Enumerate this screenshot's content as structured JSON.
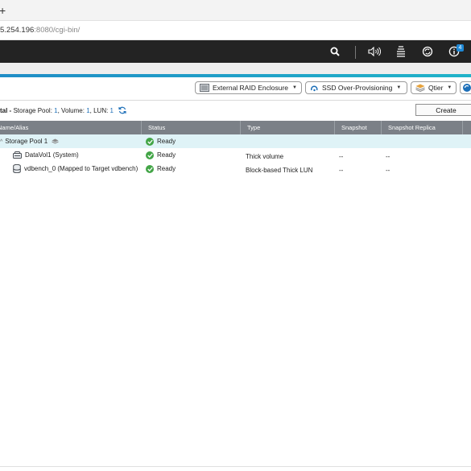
{
  "browser": {
    "new_tab_glyph": "+",
    "url_host": "5.254.196",
    "url_rest": ":8080/cgi-bin/"
  },
  "topnav": {
    "icons": [
      "search-icon",
      "volume-icon",
      "stack-icon",
      "sync-icon",
      "info-icon"
    ],
    "info_badge": "4"
  },
  "toolbar": {
    "external_raid_label": "External RAID Enclosure",
    "ssd_over_provisioning_label": "SSD Over-Provisioning",
    "qtier_label": "Qtier"
  },
  "summary": {
    "prefix": "tal - ",
    "pool_label": "Storage Pool: ",
    "pool_count": "1",
    "volume_label": ", Volume: ",
    "volume_count": "1",
    "lun_label": ", LUN: ",
    "lun_count": "1",
    "create_label": "Create"
  },
  "table": {
    "columns": [
      "Name/Alias",
      "Status",
      "Type",
      "Snapshot",
      "Snapshot Replica"
    ],
    "rows": [
      {
        "name": "Storage Pool 1",
        "status": "Ready",
        "type": "",
        "snapshot": "",
        "replica": ""
      },
      {
        "name": "DataVol1 (System)",
        "status": "Ready",
        "type": "Thick volume",
        "snapshot": "--",
        "replica": "--"
      },
      {
        "name": "vdbench_0 (Mapped to Target vdbench)",
        "status": "Ready",
        "type": "Block-based Thick LUN",
        "snapshot": "--",
        "replica": "--"
      }
    ]
  },
  "colors": {
    "accent": "#1f8dc6",
    "topnav_bg": "#232323",
    "header_bg": "#7b8087",
    "selected_row": "#dff3f7",
    "ready_green": "#43a547",
    "link_blue": "#1d6fb8"
  }
}
